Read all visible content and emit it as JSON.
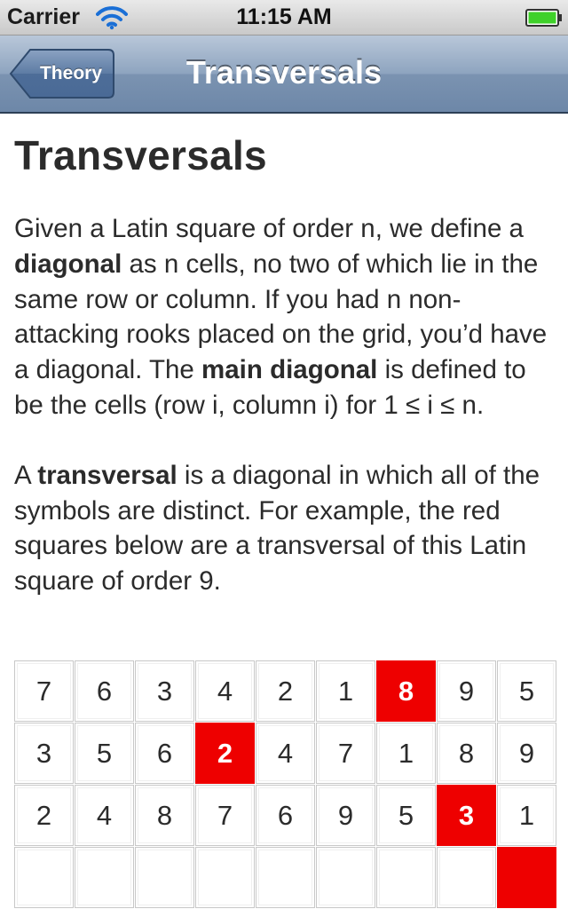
{
  "status_bar": {
    "carrier": "Carrier",
    "time": "11:15 AM",
    "wifi_icon": "wifi-icon",
    "battery_icon": "battery-icon",
    "battery_color": "#3fd12a"
  },
  "nav_bar": {
    "back_label": "Theory",
    "title": "Transversals"
  },
  "content": {
    "heading": "Transversals",
    "p1": [
      {
        "t": "Given a Latin square of order n, we define a ",
        "b": false
      },
      {
        "t": "diagonal",
        "b": true
      },
      {
        "t": " as n cells, no two of which lie in the same row or column. If you had n non-attacking rooks placed on the grid, you’d have a diagonal. The ",
        "b": false
      },
      {
        "t": "main diagonal",
        "b": true
      },
      {
        "t": " is defined to be the cells (row i, column i) for 1 ≤ i ≤ n.",
        "b": false
      }
    ],
    "p2": [
      {
        "t": "A ",
        "b": false
      },
      {
        "t": "transversal",
        "b": true
      },
      {
        "t": " is a diagonal in which all of the symbols are distinct. For example, the red squares below are a transversal of this Latin square of order 9.",
        "b": false
      }
    ]
  },
  "grid": {
    "highlight_color": "#ee0000",
    "rows": [
      [
        7,
        6,
        3,
        4,
        2,
        1,
        8,
        9,
        5
      ],
      [
        3,
        5,
        6,
        2,
        4,
        7,
        1,
        8,
        9
      ],
      [
        2,
        4,
        8,
        7,
        6,
        9,
        5,
        3,
        1
      ],
      [
        null,
        null,
        null,
        null,
        null,
        null,
        null,
        null,
        null
      ]
    ],
    "highlighted": [
      [
        0,
        6
      ],
      [
        1,
        3
      ],
      [
        2,
        7
      ],
      [
        3,
        8
      ]
    ]
  }
}
